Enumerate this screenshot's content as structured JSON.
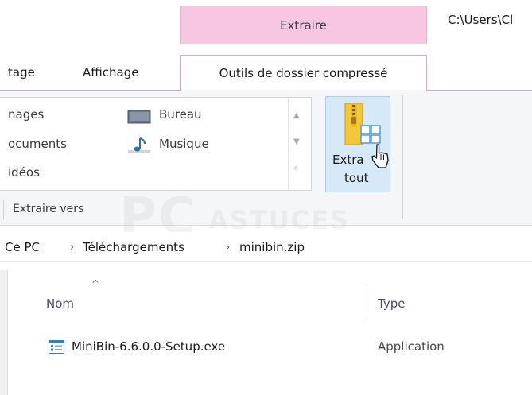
{
  "titlebar": {
    "contextual_tab_header": "Extraire",
    "window_path": "C:\\Users\\Cl"
  },
  "tabs": [
    {
      "label": "tage"
    },
    {
      "label": "Affichage"
    },
    {
      "label": "Outils de dossier compressé",
      "active": true
    }
  ],
  "ribbon": {
    "gallery_items": [
      {
        "label": "nages"
      },
      {
        "label": "ocuments"
      },
      {
        "label": "idéos"
      },
      {
        "label": "Bureau",
        "icon": "desktop-icon"
      },
      {
        "label": "Musique",
        "icon": "music-icon"
      }
    ],
    "extract_all": {
      "line1": "Extra",
      "line2": "tout",
      "icon": "zip-folder-icon"
    },
    "group_label": "Extraire vers"
  },
  "watermark": {
    "main": "PC",
    "sub": "ASTUCES"
  },
  "breadcrumb": {
    "items": [
      "Ce PC",
      "Téléchargements",
      "minibin.zip"
    ],
    "separator": "›"
  },
  "file_list": {
    "columns": [
      "Nom",
      "Type"
    ],
    "sort_indicator": "^",
    "rows": [
      {
        "name": "MiniBin-6.6.0.0-Setup.exe",
        "type": "Application",
        "icon": "application-exe-icon"
      }
    ]
  },
  "colors": {
    "contextual_tab": "#f7c6e0",
    "button_hover": "#d6e9f8",
    "ribbon_bg": "#f5f6f7"
  }
}
